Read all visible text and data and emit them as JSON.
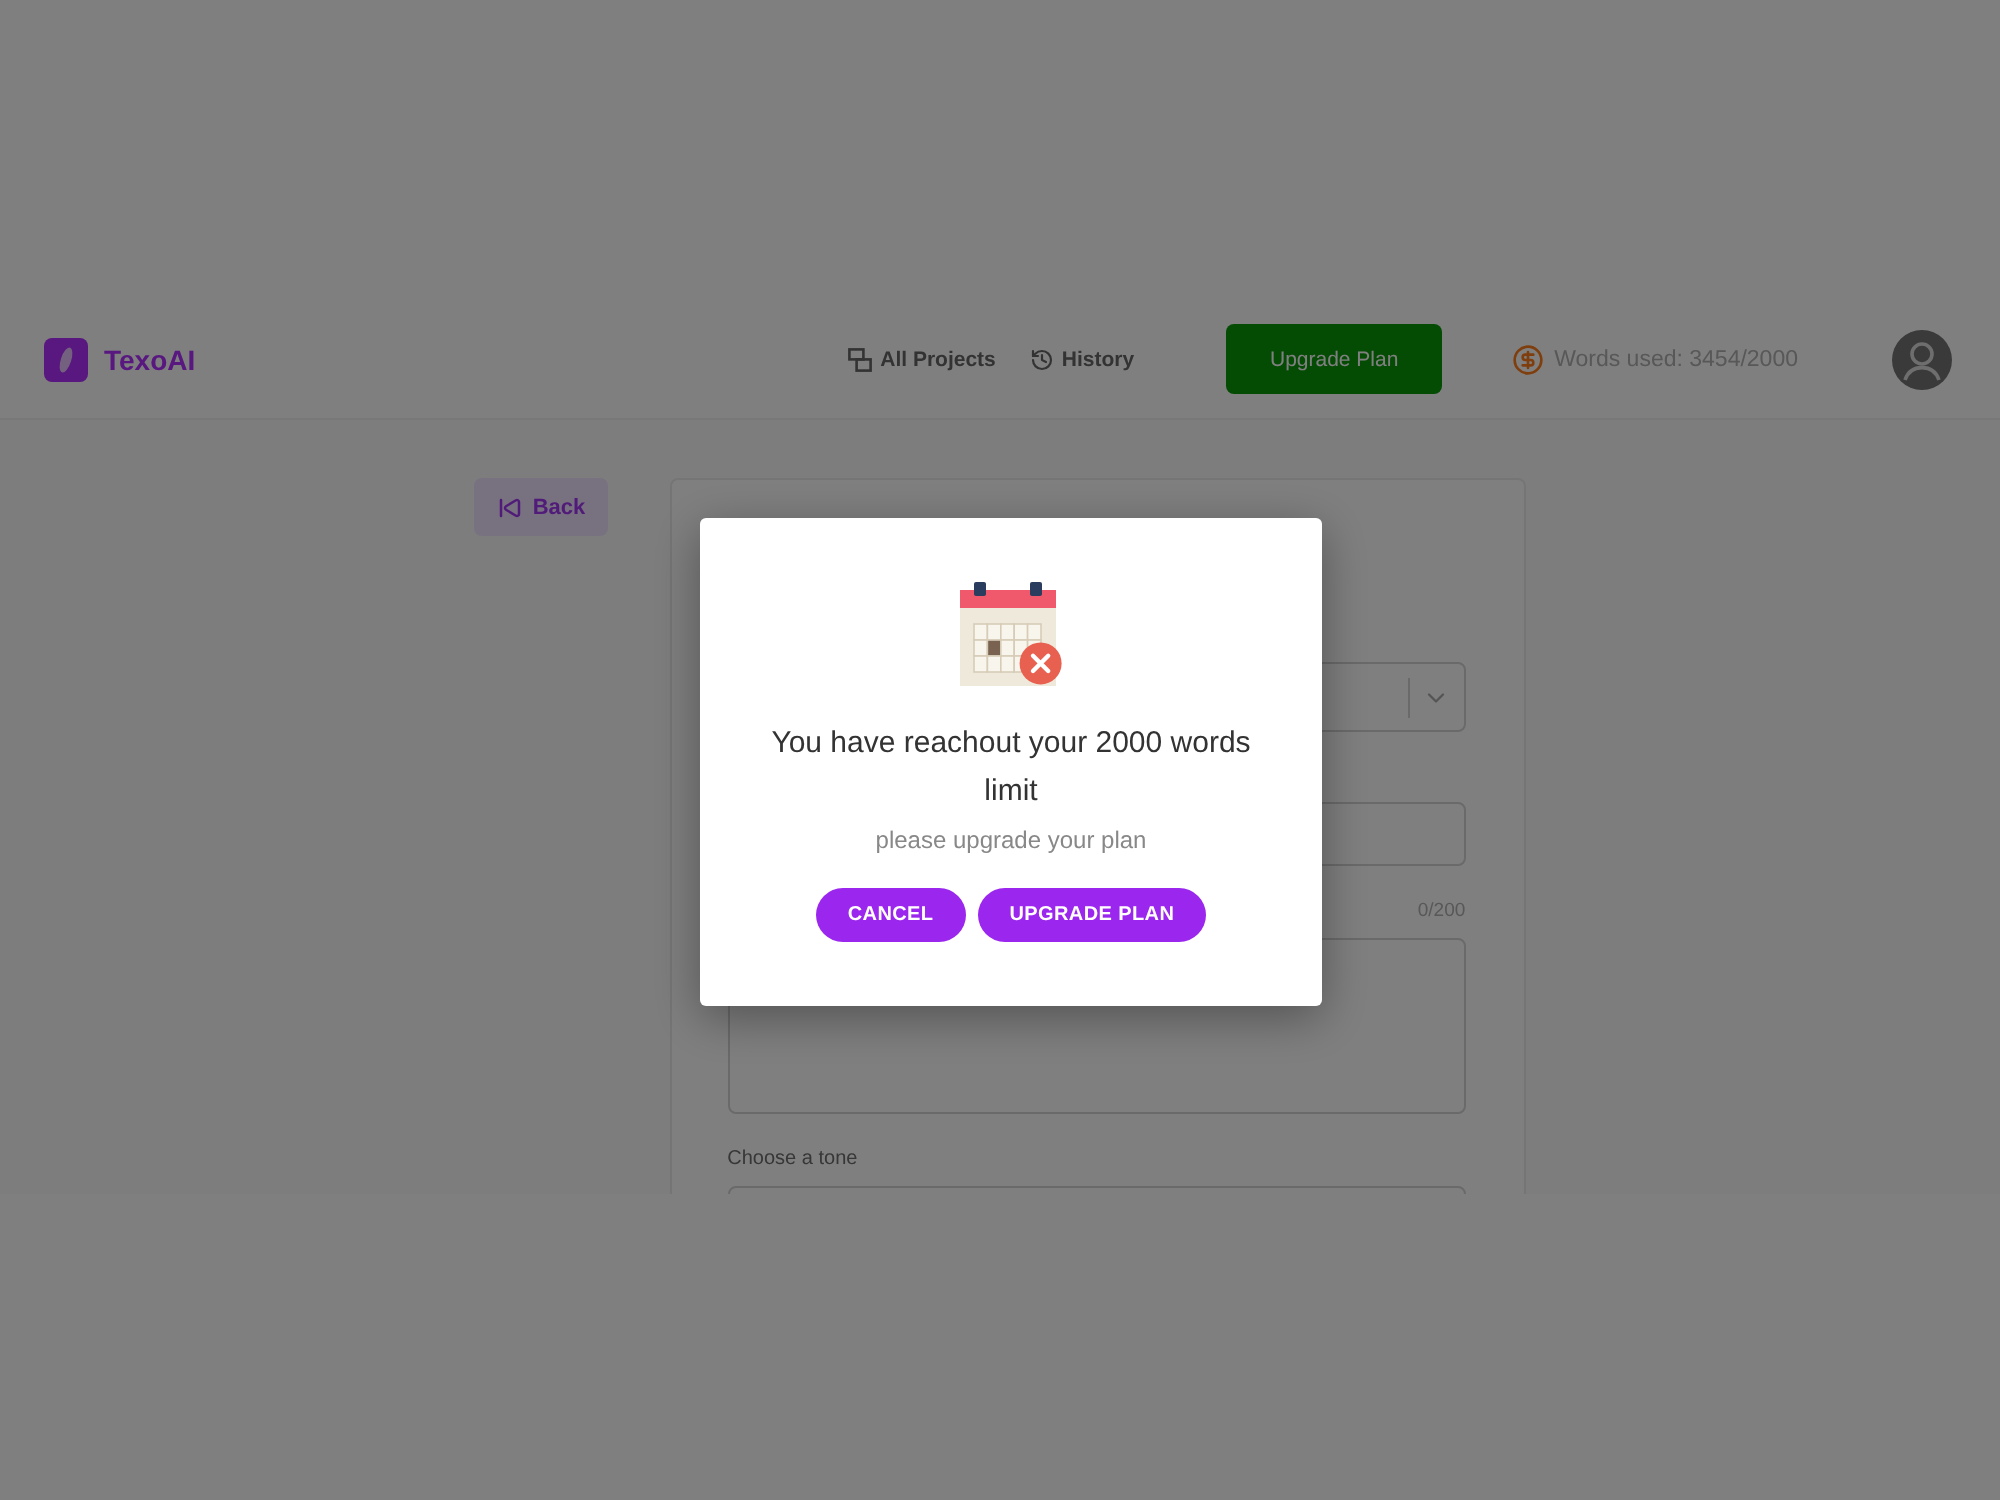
{
  "header": {
    "brand": "TexoAI",
    "nav": [
      "All Projects",
      "History"
    ],
    "upgrade_button": "Upgrade Plan",
    "words_used": "Words used: 3454/2000"
  },
  "back_button": "Back",
  "form": {
    "fields": [
      {
        "kind": "select"
      },
      {
        "kind": "input"
      },
      {
        "kind": "textarea",
        "counter": "0/200"
      },
      {
        "kind": "select",
        "label": "Choose a tone"
      }
    ]
  },
  "modal": {
    "title": "You have reachout your 2000 words limit",
    "subtitle": "please upgrade your plan",
    "buttons": [
      "CANCEL",
      "UPGRADE PLAN"
    ]
  }
}
